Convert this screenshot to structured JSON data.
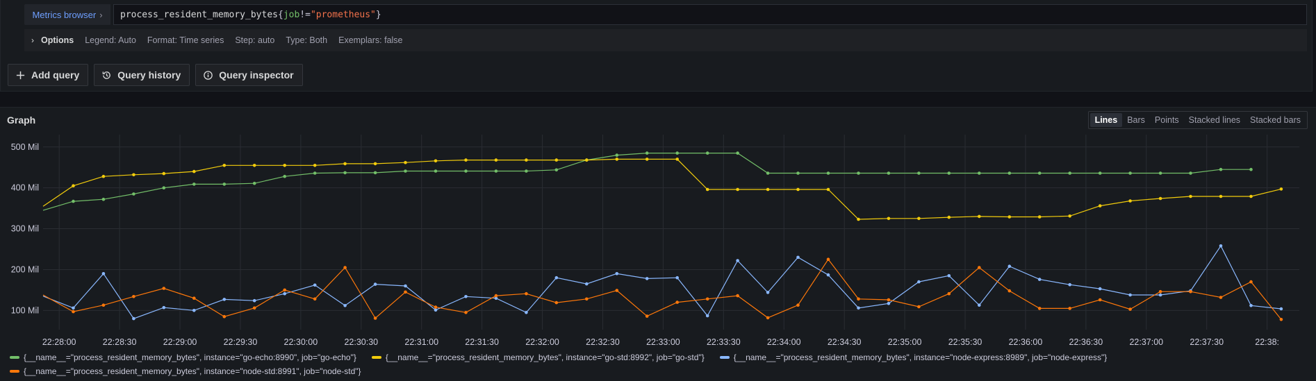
{
  "query": {
    "metrics_browser": "Metrics browser",
    "expr_metric": "process_resident_memory_bytes",
    "expr_label": "job",
    "expr_op": "!=",
    "expr_value": "\"prometheus\"",
    "options": {
      "title": "Options",
      "legend": "Legend: Auto",
      "format": "Format: Time series",
      "step": "Step: auto",
      "type": "Type: Both",
      "exemplars": "Exemplars: false"
    },
    "buttons": {
      "add": "Add query",
      "history": "Query history",
      "inspector": "Query inspector"
    }
  },
  "graph": {
    "title": "Graph",
    "views": [
      "Lines",
      "Bars",
      "Points",
      "Stacked lines",
      "Stacked bars"
    ],
    "active_view": "Lines"
  },
  "colors": {
    "go_echo": "#73bf69",
    "go_std": "#f2cc0c",
    "node_express": "#8ab8ff",
    "node_std": "#ff780a"
  },
  "chart_data": {
    "type": "line",
    "y_ticks": [
      "100 Mil",
      "200 Mil",
      "300 Mil",
      "400 Mil",
      "500 Mil"
    ],
    "y_tick_values": [
      100,
      200,
      300,
      400,
      500
    ],
    "ylim": [
      70,
      520
    ],
    "x_tick_labels": [
      "22:28:00",
      "22:28:30",
      "22:29:00",
      "22:29:30",
      "22:30:00",
      "22:30:30",
      "22:31:00",
      "22:31:30",
      "22:32:00",
      "22:32:30",
      "22:33:00",
      "22:33:30",
      "22:34:00",
      "22:34:30",
      "22:35:00",
      "22:35:30",
      "22:36:00",
      "22:36:30",
      "22:37:00",
      "22:37:30",
      "22:38:"
    ],
    "grid": true,
    "legend_position": "bottom",
    "x_start": "22:27:52",
    "x_end": "22:38:16",
    "point_interval_seconds": 15,
    "series": [
      {
        "name": "{__name__=\"process_resident_memory_bytes\", instance=\"go-echo:8990\", job=\"go-echo\"}",
        "color_key": "go_echo",
        "values": [
          345,
          367,
          372,
          385,
          400,
          409,
          409,
          411,
          428,
          436,
          437,
          437,
          441,
          441,
          441,
          441,
          441,
          444,
          468,
          480,
          485,
          485,
          485,
          485,
          436,
          436,
          436,
          436,
          436,
          436,
          436,
          436,
          436,
          436,
          436,
          436,
          436,
          436,
          436,
          445,
          445
        ]
      },
      {
        "name": "{__name__=\"process_resident_memory_bytes\", instance=\"go-std:8992\", job=\"go-std\"}",
        "color_key": "go_std",
        "values": [
          355,
          405,
          428,
          432,
          435,
          440,
          455,
          455,
          455,
          455,
          459,
          459,
          462,
          466,
          468,
          468,
          468,
          468,
          468,
          470,
          470,
          470,
          396,
          396,
          396,
          396,
          396,
          323,
          325,
          325,
          328,
          330,
          329,
          329,
          331,
          356,
          368,
          374,
          379,
          379,
          379,
          397
        ]
      },
      {
        "name": "{__name__=\"process_resident_memory_bytes\", instance=\"node-express:8989\", job=\"node-express\"}",
        "color_key": "node_express",
        "values": [
          135,
          106,
          190,
          80,
          107,
          100,
          127,
          124,
          141,
          162,
          112,
          164,
          160,
          101,
          134,
          130,
          95,
          180,
          165,
          190,
          178,
          180,
          87,
          222,
          144,
          230,
          187,
          106,
          117,
          170,
          185,
          113,
          208,
          176,
          163,
          153,
          138,
          138,
          148,
          258,
          112,
          104
        ]
      },
      {
        "name": "{__name__=\"process_resident_memory_bytes\", instance=\"node-std:8991\", job=\"node-std\"}",
        "color_key": "node_std",
        "values": [
          138,
          97,
          113,
          134,
          154,
          130,
          85,
          106,
          150,
          128,
          205,
          81,
          145,
          108,
          95,
          136,
          141,
          119,
          128,
          149,
          86,
          120,
          128,
          136,
          82,
          113,
          225,
          128,
          126,
          109,
          141,
          205,
          148,
          105,
          105,
          126,
          103,
          146,
          146,
          132,
          170,
          78
        ]
      }
    ]
  }
}
